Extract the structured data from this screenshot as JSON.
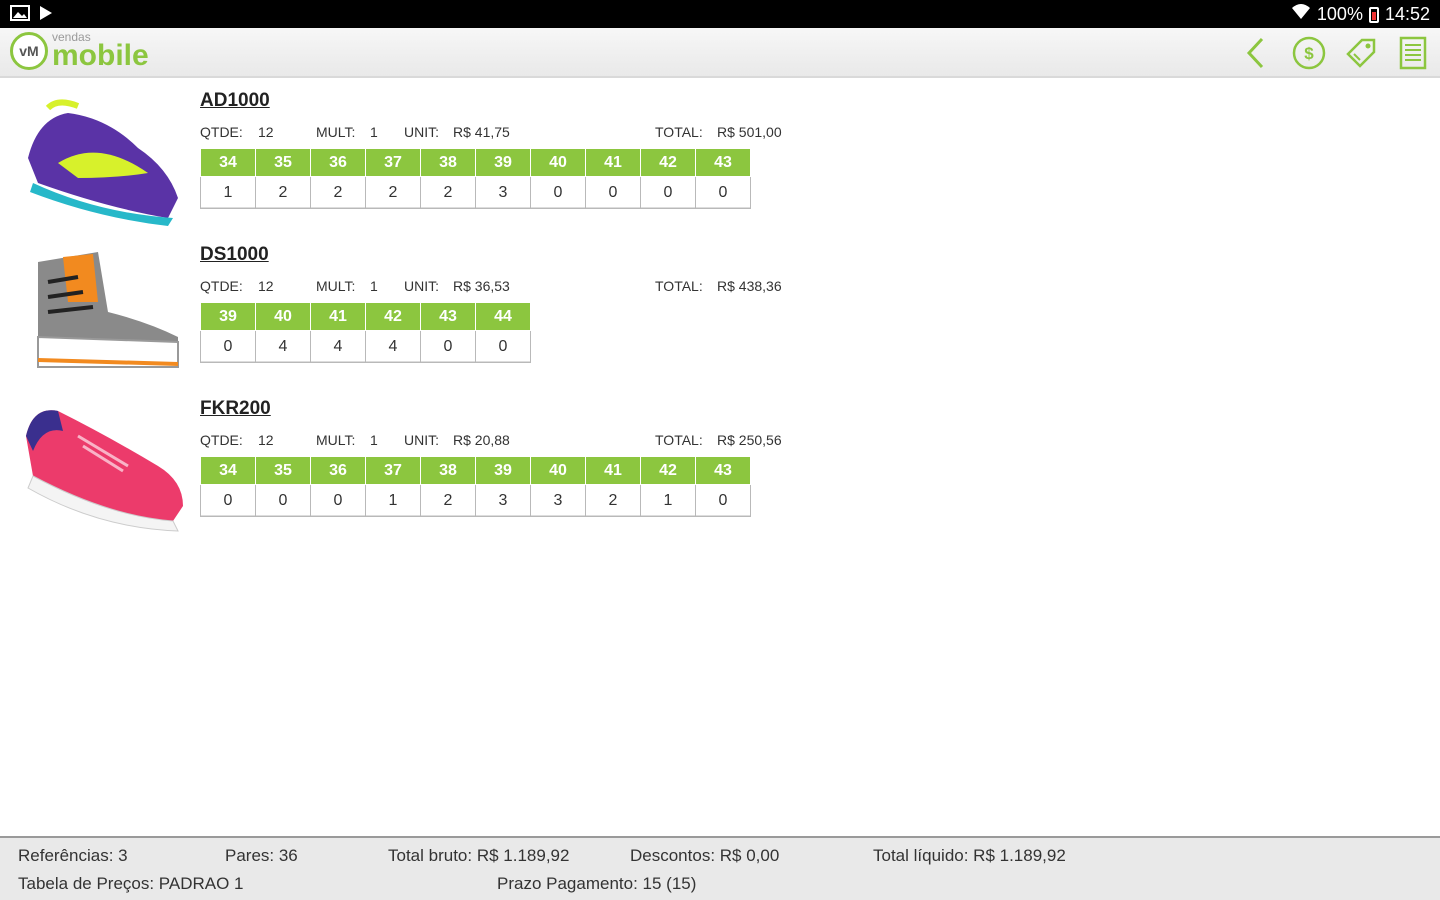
{
  "statusbar": {
    "battery": "100%",
    "time": "14:52",
    "left_icons": [
      "image-icon",
      "play-store-icon"
    ],
    "right_icons": [
      "wifi-icon",
      "battery-icon"
    ]
  },
  "appbar": {
    "logo_small": "vendas",
    "logo_big": "mobile",
    "logo_mark": "vM",
    "actions": [
      "back-icon",
      "dollar-icon",
      "tag-icon",
      "list-icon"
    ]
  },
  "labels": {
    "qtde": "QTDE:",
    "mult": "MULT:",
    "unit": "UNIT:",
    "total": "TOTAL:"
  },
  "products": [
    {
      "ref": "AD1000",
      "qtde": "12",
      "mult": "1",
      "unit": "R$ 41,75",
      "total": "R$ 501,00",
      "colors": {
        "upper": "#5a33a6",
        "accent": "#d7f12b",
        "sole": "#27b8c9"
      },
      "sizes": [
        "34",
        "35",
        "36",
        "37",
        "38",
        "39",
        "40",
        "41",
        "42",
        "43"
      ],
      "qty": [
        "1",
        "2",
        "2",
        "2",
        "2",
        "3",
        "0",
        "0",
        "0",
        "0"
      ]
    },
    {
      "ref": "DS1000",
      "qtde": "12",
      "mult": "1",
      "unit": "R$ 36,53",
      "total": "R$ 438,36",
      "colors": {
        "upper": "#8a8a8a",
        "accent": "#f28a1f",
        "sole": "#ffffff"
      },
      "sizes": [
        "39",
        "40",
        "41",
        "42",
        "43",
        "44"
      ],
      "qty": [
        "0",
        "4",
        "4",
        "4",
        "0",
        "0"
      ]
    },
    {
      "ref": "FKR200",
      "qtde": "12",
      "mult": "1",
      "unit": "R$ 20,88",
      "total": "R$ 250,56",
      "colors": {
        "upper": "#ec3b6b",
        "accent": "#3a2f8e",
        "sole": "#f4f4f4"
      },
      "sizes": [
        "34",
        "35",
        "36",
        "37",
        "38",
        "39",
        "40",
        "41",
        "42",
        "43"
      ],
      "qty": [
        "0",
        "0",
        "0",
        "1",
        "2",
        "3",
        "3",
        "2",
        "1",
        "0"
      ]
    }
  ],
  "footer": {
    "referencias": "Referências: 3",
    "pares": "Pares: 36",
    "total_bruto": "Total bruto: R$ 1.189,92",
    "descontos": "Descontos: R$ 0,00",
    "total_liquido": "Total líquido: R$ 1.189,92",
    "tabela_precos": "Tabela de Preços: PADRAO 1",
    "prazo": "Prazo Pagamento: 15 (15)"
  },
  "theme": {
    "accent": "#8cc63f",
    "statusbar_bg": "#000000",
    "footer_bg": "#e9e9e9"
  }
}
